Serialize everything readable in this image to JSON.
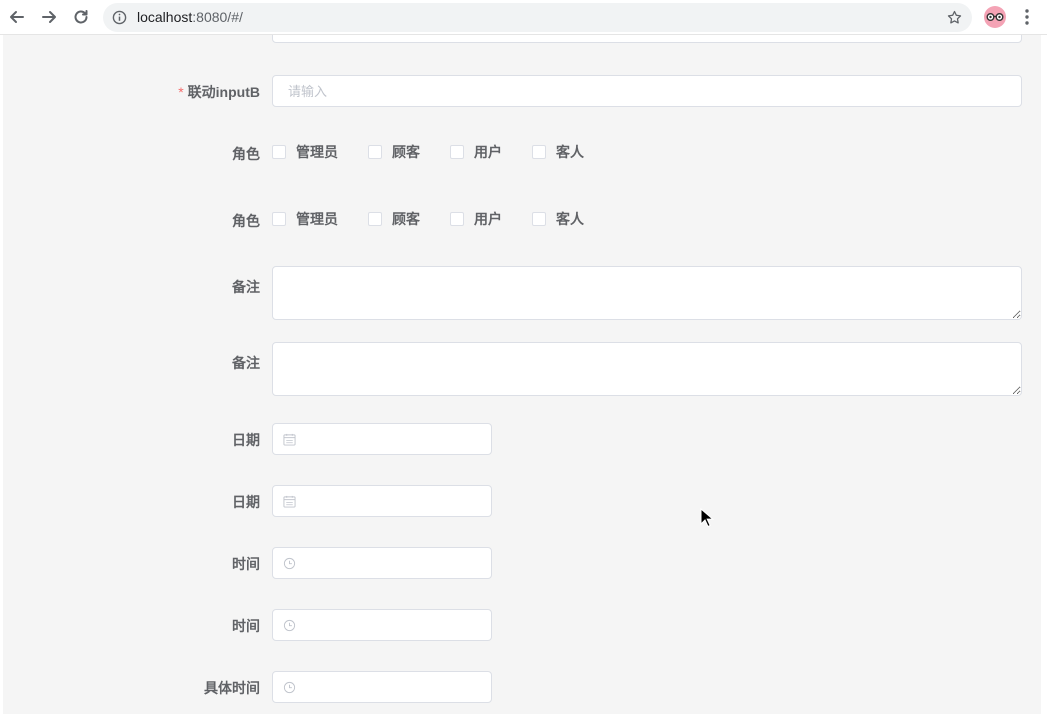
{
  "browser": {
    "url_host": "localhost",
    "url_rest": ":8080/#/"
  },
  "form": {
    "linked_input": {
      "label": "联动inputB",
      "required_mark": "*",
      "placeholder": "请输入"
    },
    "role_group_1": {
      "label": "角色",
      "options": [
        "管理员",
        "顾客",
        "用户",
        "客人"
      ]
    },
    "role_group_2": {
      "label": "角色",
      "options": [
        "管理员",
        "顾客",
        "用户",
        "客人"
      ]
    },
    "remark_1": {
      "label": "备注"
    },
    "remark_2": {
      "label": "备注"
    },
    "date_1": {
      "label": "日期"
    },
    "date_2": {
      "label": "日期"
    },
    "time_1": {
      "label": "时间"
    },
    "time_2": {
      "label": "时间"
    },
    "exact_time": {
      "label": "具体时间"
    }
  },
  "icons": {
    "back": "arrow-left-icon",
    "forward": "arrow-right-icon",
    "reload": "reload-icon",
    "info": "info-icon",
    "bookmark": "star-icon",
    "menu": "kebab-icon",
    "date": "calendar-icon",
    "time": "clock-icon"
  },
  "colors": {
    "page_bg": "#f5f5f5",
    "required": "#f56c6c",
    "label": "#606266",
    "border": "#dcdfe6",
    "placeholder": "#c0c4cc",
    "avatar": "#f4a3b5"
  }
}
